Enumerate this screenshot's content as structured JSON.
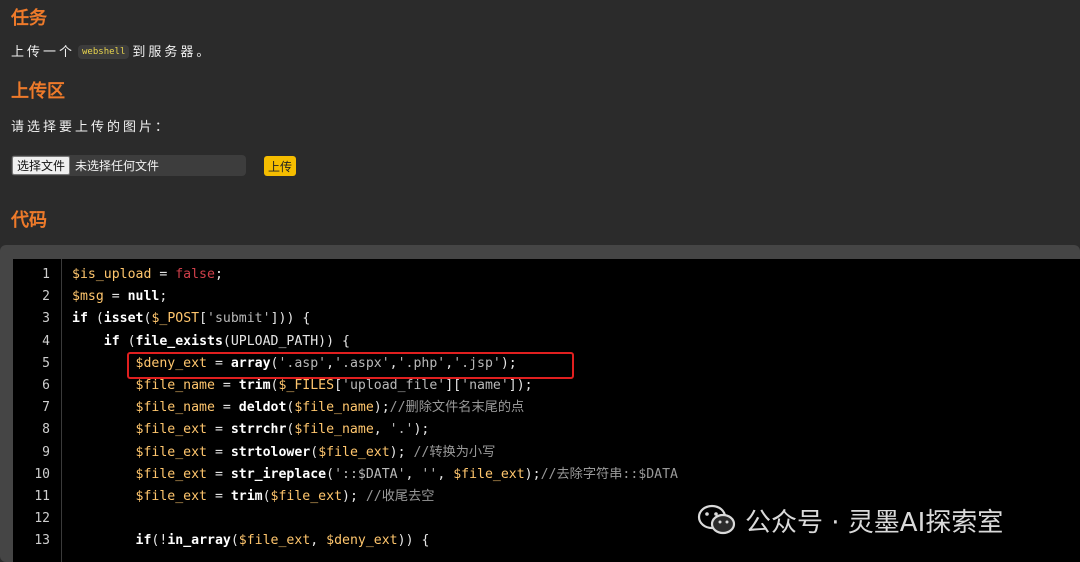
{
  "task": {
    "heading": "任务",
    "text_prefix": "上传一个",
    "code": "webshell",
    "text_suffix": "到服务器。"
  },
  "upload": {
    "heading": "上传区",
    "prompt": "请选择要上传的图片：",
    "choose_button": "选择文件",
    "file_status": "未选择任何文件",
    "submit_button": "上传"
  },
  "code_section": {
    "heading": "代码",
    "line_numbers": [
      "1",
      "2",
      "3",
      "4",
      "5",
      "6",
      "7",
      "8",
      "9",
      "10",
      "11",
      "12",
      "13"
    ],
    "lines": [
      [
        {
          "t": "$is_upload",
          "c": "v"
        },
        {
          "t": " = ",
          "c": ""
        },
        {
          "t": "false",
          "c": "s"
        },
        {
          "t": ";",
          "c": ""
        }
      ],
      [
        {
          "t": "$msg",
          "c": "v"
        },
        {
          "t": " = ",
          "c": ""
        },
        {
          "t": "null",
          "c": "k"
        },
        {
          "t": ";",
          "c": ""
        }
      ],
      [
        {
          "t": "if",
          "c": "k"
        },
        {
          "t": " (",
          "c": ""
        },
        {
          "t": "isset",
          "c": "k"
        },
        {
          "t": "(",
          "c": ""
        },
        {
          "t": "$_POST",
          "c": "v"
        },
        {
          "t": "[",
          "c": ""
        },
        {
          "t": "'submit'",
          "c": "str"
        },
        {
          "t": "])) {",
          "c": ""
        }
      ],
      [
        {
          "t": "    ",
          "c": ""
        },
        {
          "t": "if",
          "c": "k"
        },
        {
          "t": " (",
          "c": ""
        },
        {
          "t": "file_exists",
          "c": "k"
        },
        {
          "t": "(UPLOAD_PATH)) {",
          "c": ""
        }
      ],
      [
        {
          "t": "        ",
          "c": ""
        },
        {
          "t": "$deny_ext",
          "c": "v"
        },
        {
          "t": " = ",
          "c": ""
        },
        {
          "t": "array",
          "c": "k"
        },
        {
          "t": "(",
          "c": ""
        },
        {
          "t": "'.asp'",
          "c": "str"
        },
        {
          "t": ",",
          "c": ""
        },
        {
          "t": "'.aspx'",
          "c": "str"
        },
        {
          "t": ",",
          "c": ""
        },
        {
          "t": "'.php'",
          "c": "str"
        },
        {
          "t": ",",
          "c": ""
        },
        {
          "t": "'.jsp'",
          "c": "str"
        },
        {
          "t": ");",
          "c": ""
        }
      ],
      [
        {
          "t": "        ",
          "c": ""
        },
        {
          "t": "$file_name",
          "c": "v"
        },
        {
          "t": " = ",
          "c": ""
        },
        {
          "t": "trim",
          "c": "k"
        },
        {
          "t": "(",
          "c": ""
        },
        {
          "t": "$_FILES",
          "c": "v"
        },
        {
          "t": "[",
          "c": ""
        },
        {
          "t": "'upload_file'",
          "c": "str"
        },
        {
          "t": "][",
          "c": ""
        },
        {
          "t": "'name'",
          "c": "str"
        },
        {
          "t": "]);",
          "c": ""
        }
      ],
      [
        {
          "t": "        ",
          "c": ""
        },
        {
          "t": "$file_name",
          "c": "v"
        },
        {
          "t": " = ",
          "c": ""
        },
        {
          "t": "deldot",
          "c": "k"
        },
        {
          "t": "(",
          "c": ""
        },
        {
          "t": "$file_name",
          "c": "v"
        },
        {
          "t": ");",
          "c": ""
        },
        {
          "t": "//删除文件名末尾的点",
          "c": "c"
        }
      ],
      [
        {
          "t": "        ",
          "c": ""
        },
        {
          "t": "$file_ext",
          "c": "v"
        },
        {
          "t": " = ",
          "c": ""
        },
        {
          "t": "strrchr",
          "c": "k"
        },
        {
          "t": "(",
          "c": ""
        },
        {
          "t": "$file_name",
          "c": "v"
        },
        {
          "t": ", ",
          "c": ""
        },
        {
          "t": "'.'",
          "c": "str"
        },
        {
          "t": ");",
          "c": ""
        }
      ],
      [
        {
          "t": "        ",
          "c": ""
        },
        {
          "t": "$file_ext",
          "c": "v"
        },
        {
          "t": " = ",
          "c": ""
        },
        {
          "t": "strtolower",
          "c": "k"
        },
        {
          "t": "(",
          "c": ""
        },
        {
          "t": "$file_ext",
          "c": "v"
        },
        {
          "t": "); ",
          "c": ""
        },
        {
          "t": "//转换为小写",
          "c": "c"
        }
      ],
      [
        {
          "t": "        ",
          "c": ""
        },
        {
          "t": "$file_ext",
          "c": "v"
        },
        {
          "t": " = ",
          "c": ""
        },
        {
          "t": "str_ireplace",
          "c": "k"
        },
        {
          "t": "(",
          "c": ""
        },
        {
          "t": "'::$DATA'",
          "c": "str"
        },
        {
          "t": ", ",
          "c": ""
        },
        {
          "t": "''",
          "c": "str"
        },
        {
          "t": ", ",
          "c": ""
        },
        {
          "t": "$file_ext",
          "c": "v"
        },
        {
          "t": ");",
          "c": ""
        },
        {
          "t": "//去除字符串::$DATA",
          "c": "c"
        }
      ],
      [
        {
          "t": "        ",
          "c": ""
        },
        {
          "t": "$file_ext",
          "c": "v"
        },
        {
          "t": " = ",
          "c": ""
        },
        {
          "t": "trim",
          "c": "k"
        },
        {
          "t": "(",
          "c": ""
        },
        {
          "t": "$file_ext",
          "c": "v"
        },
        {
          "t": "); ",
          "c": ""
        },
        {
          "t": "//收尾去空",
          "c": "c"
        }
      ],
      [],
      [
        {
          "t": "        ",
          "c": ""
        },
        {
          "t": "if",
          "c": "k"
        },
        {
          "t": "(!",
          "c": ""
        },
        {
          "t": "in_array",
          "c": "k"
        },
        {
          "t": "(",
          "c": ""
        },
        {
          "t": "$file_ext",
          "c": "v"
        },
        {
          "t": ", ",
          "c": ""
        },
        {
          "t": "$deny_ext",
          "c": "v"
        },
        {
          "t": ")) {",
          "c": ""
        }
      ]
    ]
  },
  "watermark": {
    "text": "公众号 · 灵墨AI探索室",
    "icon": "wechat-icon"
  },
  "colors": {
    "heading": "#ee7a2a",
    "highlight_box": "#e01f1f",
    "upload_button": "#f5bd00"
  }
}
